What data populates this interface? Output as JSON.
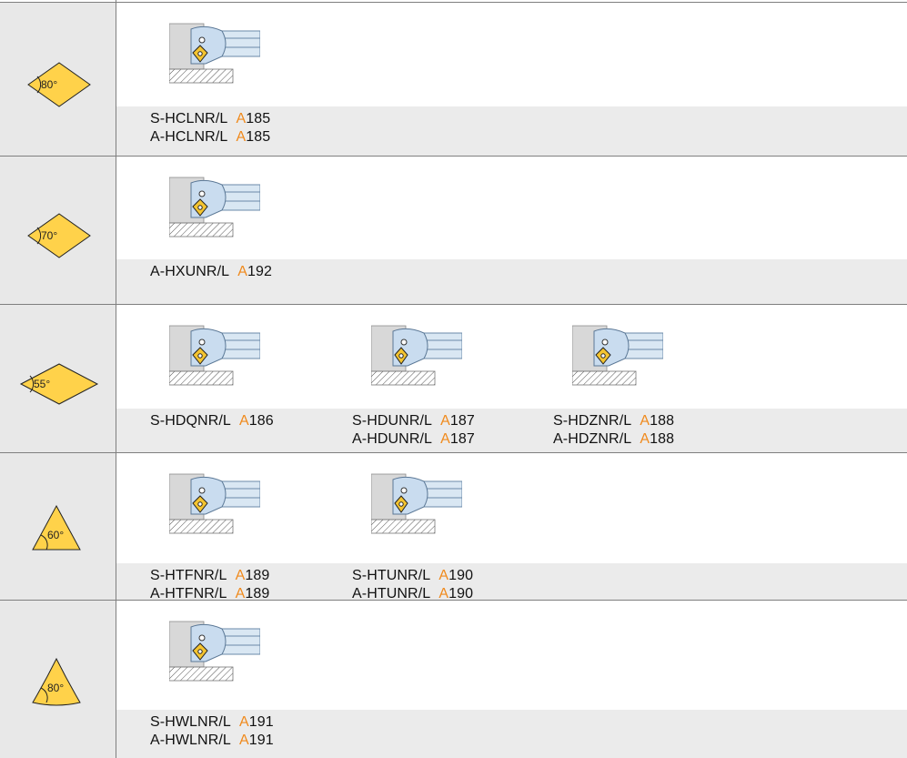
{
  "colors": {
    "insert_fill": "#ffd24a",
    "page_ref": "#f08a1c",
    "band": "#ebebeb",
    "left_column": "#e8e8e8"
  },
  "rows": [
    {
      "insert": {
        "shape": "rhombic",
        "angle": "80°"
      },
      "tools": [
        {
          "icon": "boring-bar-tool-icon",
          "codes": [
            {
              "name": "S-HCLNR/L",
              "page": "A",
              "num": "185"
            },
            {
              "name": "A-HCLNR/L",
              "page": "A",
              "num": "185"
            }
          ]
        }
      ]
    },
    {
      "insert": {
        "shape": "rhombic",
        "angle": "70°"
      },
      "tools": [
        {
          "icon": "boring-bar-tool-icon",
          "codes": [
            {
              "name": "A-HXUNR/L",
              "page": "A",
              "num": "192"
            }
          ]
        }
      ]
    },
    {
      "insert": {
        "shape": "rhombic",
        "angle": "55°"
      },
      "tools": [
        {
          "icon": "boring-bar-tool-icon",
          "codes": [
            {
              "name": "S-HDQNR/L",
              "page": "A",
              "num": "186"
            }
          ]
        },
        {
          "icon": "boring-bar-tool-icon",
          "codes": [
            {
              "name": "S-HDUNR/L",
              "page": "A",
              "num": "187"
            },
            {
              "name": "A-HDUNR/L",
              "page": "A",
              "num": "187"
            }
          ]
        },
        {
          "icon": "boring-bar-tool-icon",
          "codes": [
            {
              "name": "S-HDZNR/L",
              "page": "A",
              "num": "188"
            },
            {
              "name": "A-HDZNR/L",
              "page": "A",
              "num": "188"
            }
          ]
        }
      ]
    },
    {
      "insert": {
        "shape": "triangle",
        "angle": "60°"
      },
      "tools": [
        {
          "icon": "boring-bar-tool-icon",
          "codes": [
            {
              "name": "S-HTFNR/L",
              "page": "A",
              "num": "189"
            },
            {
              "name": "A-HTFNR/L",
              "page": "A",
              "num": "189"
            }
          ]
        },
        {
          "icon": "boring-bar-tool-icon",
          "codes": [
            {
              "name": "S-HTUNR/L",
              "page": "A",
              "num": "190"
            },
            {
              "name": "A-HTUNR/L",
              "page": "A",
              "num": "190"
            }
          ]
        }
      ]
    },
    {
      "insert": {
        "shape": "trigon",
        "angle": "80°"
      },
      "tools": [
        {
          "icon": "boring-bar-tool-icon",
          "codes": [
            {
              "name": "S-HWLNR/L",
              "page": "A",
              "num": "191"
            },
            {
              "name": "A-HWLNR/L",
              "page": "A",
              "num": "191"
            }
          ]
        }
      ]
    }
  ]
}
